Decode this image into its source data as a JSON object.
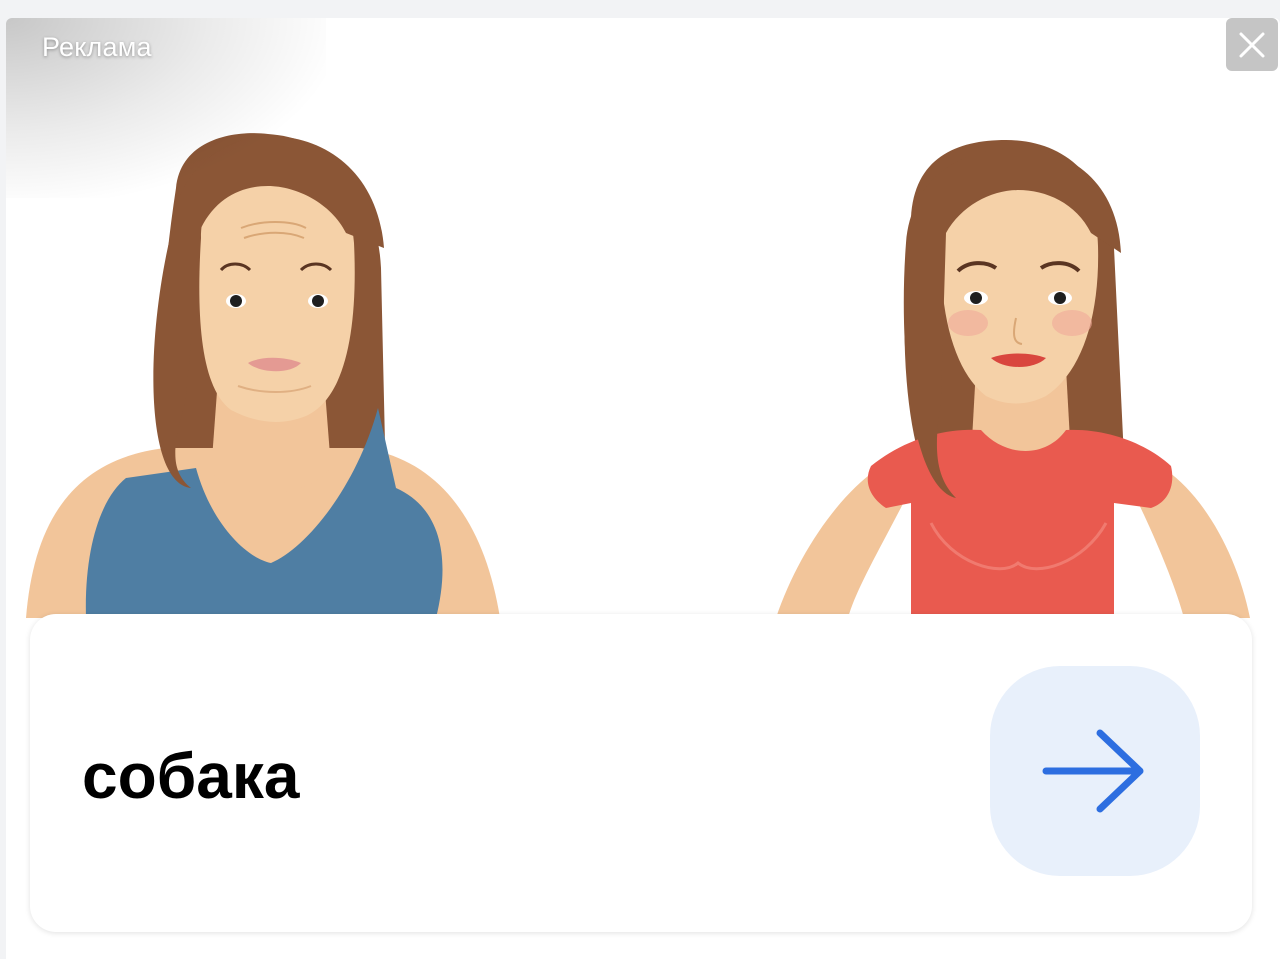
{
  "ad": {
    "label": "Реклама",
    "caption": "собака",
    "close_icon": "close-icon",
    "action_icon": "arrow-right-icon"
  },
  "colors": {
    "background": "#ffffff",
    "accent": "#2d6ee0",
    "action_button_bg": "#e8f0fb",
    "hair": "#8b5636",
    "skin": "#f2c59a",
    "left_top": "#4f7ea3",
    "right_top": "#e95a4f"
  }
}
